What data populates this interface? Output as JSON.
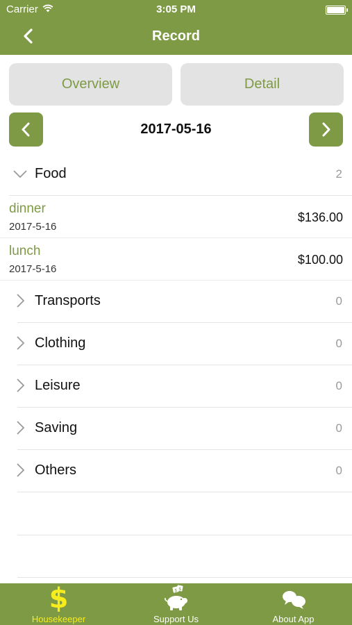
{
  "status_bar": {
    "carrier": "Carrier",
    "time": "3:05 PM"
  },
  "nav": {
    "title": "Record"
  },
  "segments": {
    "overview": "Overview",
    "detail": "Detail"
  },
  "date": "2017-05-16",
  "categories": [
    {
      "name": "Food",
      "count": "2",
      "expanded": true,
      "items": [
        {
          "name": "dinner",
          "date": "2017-5-16",
          "amount": "$136.00"
        },
        {
          "name": "lunch",
          "date": "2017-5-16",
          "amount": "$100.00"
        }
      ]
    },
    {
      "name": "Transports",
      "count": "0",
      "expanded": false
    },
    {
      "name": "Clothing",
      "count": "0",
      "expanded": false
    },
    {
      "name": "Leisure",
      "count": "0",
      "expanded": false
    },
    {
      "name": "Saving",
      "count": "0",
      "expanded": false
    },
    {
      "name": "Others",
      "count": "0",
      "expanded": false
    }
  ],
  "tabs": [
    {
      "label": "Housekeeper",
      "icon": "dollar-icon",
      "active": true
    },
    {
      "label": "Support Us",
      "icon": "piggy-bank-icon",
      "active": false
    },
    {
      "label": "About App",
      "icon": "chat-bubbles-icon",
      "active": false
    }
  ],
  "colors": {
    "brand": "#7e9a45",
    "active_tab": "#f7ec1c",
    "segment_bg": "#e3e3e3"
  }
}
